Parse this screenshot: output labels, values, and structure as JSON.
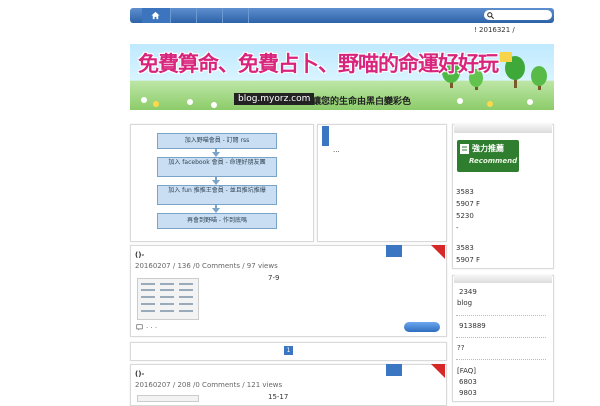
{
  "nav": {
    "home_label": "home"
  },
  "topbar": {
    "text": "!     2016321  /"
  },
  "banner": {
    "title": "免費算命、免費占卜、野喵的命運好好玩",
    "site": "blog.myorz.com",
    "slogan": "讓您的生命由黑白變彩色"
  },
  "flow": [
    "加入野喵會員 - 訂閱 rss",
    "加入 facebook 會員 - 命理好朋友團",
    "加入 fun 推推王會員 - 並且推坑推爆",
    "再會到野喵 - 作到底嗎"
  ],
  "side_panel_text": "...",
  "sidebar": {
    "badge_title": "強力推薦",
    "badge_sub": "Recommend",
    "lines1": [
      "3583",
      "5907 F",
      "5230",
      "-"
    ],
    "lines2": [
      "3583",
      "5907 F"
    ],
    "lines3": [
      "2349",
      "blog",
      "913889",
      "??",
      "[FAQ]",
      "6803",
      "9803"
    ]
  },
  "posts": [
    {
      "title": "()-",
      "meta": "20160207 /  136   /0 Comments /  97 views",
      "excerpt": "7-9",
      "footer": "· · ·"
    },
    {
      "title": "()-",
      "meta": "20160207 /  208   /0 Comments /  121 views",
      "excerpt": "15-17"
    }
  ],
  "pager": {
    "current": "1"
  }
}
